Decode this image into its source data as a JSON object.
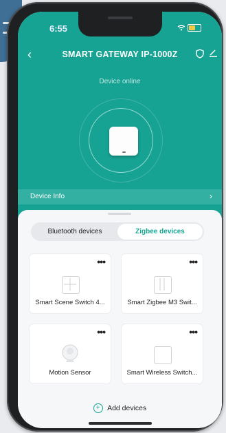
{
  "status_bar": {
    "time": "6:55"
  },
  "nav": {
    "back_symbol": "‹",
    "title": "SMART GATEWAY IP-1000Z"
  },
  "device_status": "Device online",
  "device_info_label": "Device Info",
  "tabs": [
    {
      "label": "Bluetooth devices",
      "selected": false
    },
    {
      "label": "Zigbee devices",
      "selected": true
    }
  ],
  "devices": [
    {
      "name": "Smart Scene Switch 4...",
      "icon": "four-gang-switch-icon",
      "more": "•••"
    },
    {
      "name": "Smart Zigbee M3 Swit...",
      "icon": "three-gang-switch-icon",
      "more": "•••"
    },
    {
      "name": "Motion Sensor",
      "icon": "motion-sensor-icon",
      "more": "•••"
    },
    {
      "name": "Smart Wireless Switch...",
      "icon": "single-switch-icon",
      "more": "•••"
    }
  ],
  "add_devices_label": "Add devices",
  "colors": {
    "accent": "#17a394",
    "accent_text": "#14a693",
    "info_bar": "#34b0a2"
  }
}
